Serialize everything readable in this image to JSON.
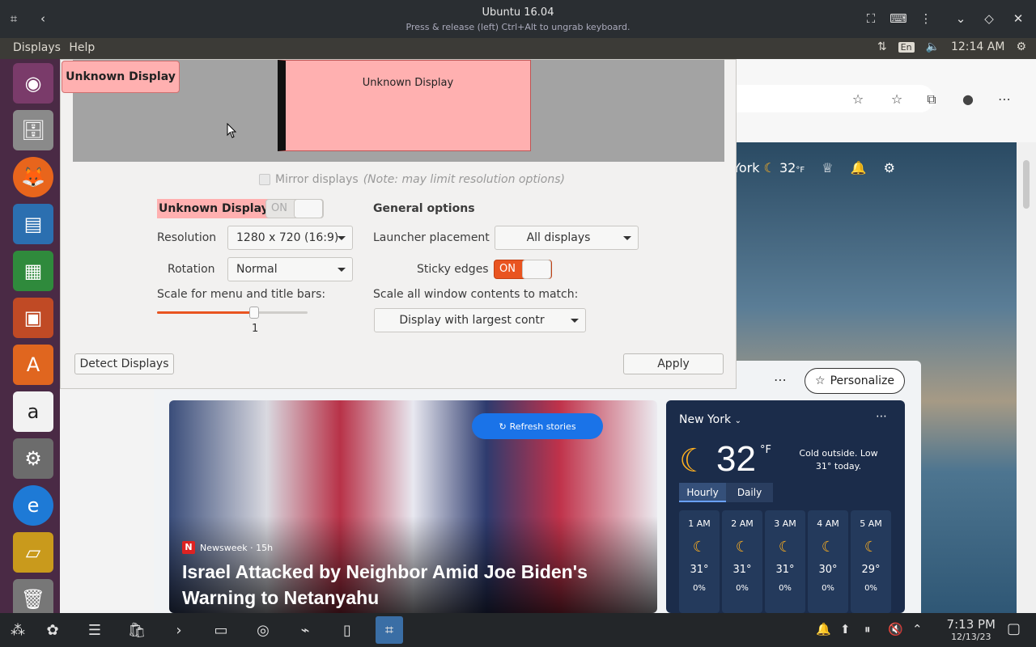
{
  "vm_window": {
    "title": "Ubuntu 16.04",
    "subtitle": "Press & release (left) Ctrl+Alt to ungrab keyboard."
  },
  "ubuntu_panel": {
    "menus": [
      "Displays",
      "Help"
    ],
    "keyboard_layout": "En",
    "time": "12:14 AM"
  },
  "browser": {
    "weather_header": {
      "city": "New York",
      "temp": "32",
      "unit": "°F"
    },
    "personalize_label": "Personalize",
    "refresh_label": "Refresh stories",
    "news": {
      "source": "Newsweek · 15h",
      "headline": "Israel Attacked by Neighbor Amid Joe Biden's Warning to Netanyahu"
    },
    "weather_card": {
      "city": "New York",
      "temp": "32",
      "unit": "°F",
      "description": "Cold outside. Low 31° today.",
      "tabs": [
        "Hourly",
        "Daily"
      ],
      "hours": [
        {
          "hour": "1 AM",
          "temp": "31°",
          "precip": "0%"
        },
        {
          "hour": "2 AM",
          "temp": "31°",
          "precip": "0%"
        },
        {
          "hour": "3 AM",
          "temp": "31°",
          "precip": "0%"
        },
        {
          "hour": "4 AM",
          "temp": "30°",
          "precip": "0%"
        },
        {
          "hour": "5 AM",
          "temp": "29°",
          "precip": "0%"
        }
      ]
    }
  },
  "displays_dialog": {
    "preview_display_label": "Unknown Display",
    "selected_display_tag": "Unknown Display",
    "mirror_label": "Mirror displays",
    "mirror_note": "(Note: may limit resolution options)",
    "display_name": "Unknown Display",
    "display_toggle": "ON",
    "resolution_label": "Resolution",
    "resolution_value": "1280 x 720 (16:9)",
    "rotation_label": "Rotation",
    "rotation_value": "Normal",
    "scale_label": "Scale for menu and title bars:",
    "scale_value": "1",
    "general_options_label": "General options",
    "launcher_placement_label": "Launcher placement",
    "launcher_placement_value": "All displays",
    "sticky_edges_label": "Sticky edges",
    "sticky_edges_toggle": "ON",
    "scale_all_label": "Scale all window contents to match:",
    "scale_all_value": "Display with largest contr",
    "detect_button": "Detect Displays",
    "apply_button": "Apply"
  },
  "taskbar": {
    "time": "7:13 PM",
    "date": "12/13/23"
  }
}
